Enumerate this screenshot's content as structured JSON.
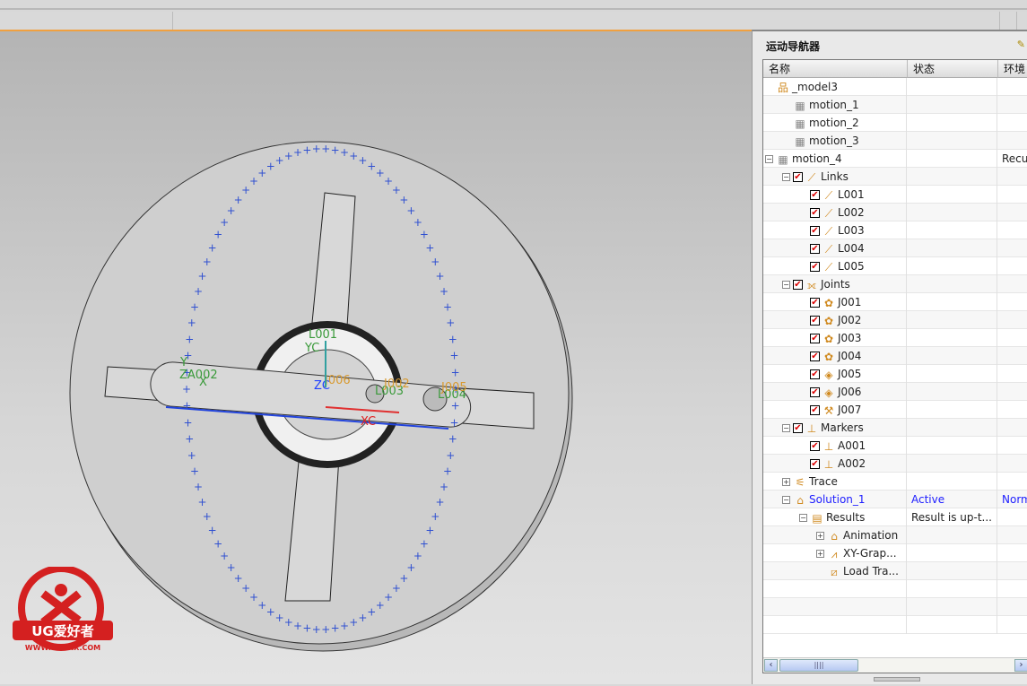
{
  "panel": {
    "title": "运动导航器",
    "columns": [
      "名称",
      "状态",
      "环境"
    ]
  },
  "tree": [
    {
      "indent": 0,
      "exp": "",
      "cb": false,
      "icon": "assembly-tree-icon",
      "glyph": "品",
      "label": "_model3",
      "status": "",
      "env": ""
    },
    {
      "indent": 1,
      "exp": "",
      "cb": false,
      "icon": "motion-sim-icon",
      "glyph": "▦",
      "label": "motion_1",
      "status": "",
      "env": ""
    },
    {
      "indent": 1,
      "exp": "",
      "cb": false,
      "icon": "motion-sim-icon",
      "glyph": "▦",
      "label": "motion_2",
      "status": "",
      "env": ""
    },
    {
      "indent": 1,
      "exp": "",
      "cb": false,
      "icon": "motion-sim-icon",
      "glyph": "▦",
      "label": "motion_3",
      "status": "",
      "env": ""
    },
    {
      "indent": 0,
      "exp": "−",
      "cb": false,
      "icon": "motion-sim-active-icon",
      "glyph": "▦",
      "label": "motion_4",
      "status": "",
      "env": "Recurdyn"
    },
    {
      "indent": 1,
      "exp": "−",
      "cb": true,
      "icon": "links-icon",
      "glyph": "⟋",
      "label": "Links",
      "status": "",
      "env": ""
    },
    {
      "indent": 2,
      "exp": "",
      "cb": true,
      "icon": "link-fixed-icon",
      "glyph": "⟋",
      "label": "L001",
      "status": "",
      "env": ""
    },
    {
      "indent": 2,
      "exp": "",
      "cb": true,
      "icon": "link-icon",
      "glyph": "⟋",
      "label": "L002",
      "status": "",
      "env": ""
    },
    {
      "indent": 2,
      "exp": "",
      "cb": true,
      "icon": "link-icon",
      "glyph": "⟋",
      "label": "L003",
      "status": "",
      "env": ""
    },
    {
      "indent": 2,
      "exp": "",
      "cb": true,
      "icon": "link-icon",
      "glyph": "⟋",
      "label": "L004",
      "status": "",
      "env": ""
    },
    {
      "indent": 2,
      "exp": "",
      "cb": true,
      "icon": "link-icon",
      "glyph": "⟋",
      "label": "L005",
      "status": "",
      "env": ""
    },
    {
      "indent": 1,
      "exp": "−",
      "cb": true,
      "icon": "joints-icon",
      "glyph": "⟗",
      "label": "Joints",
      "status": "",
      "env": ""
    },
    {
      "indent": 2,
      "exp": "",
      "cb": true,
      "icon": "revolute-joint-icon",
      "glyph": "✿",
      "label": "J001",
      "status": "",
      "env": ""
    },
    {
      "indent": 2,
      "exp": "",
      "cb": true,
      "icon": "revolute-joint-icon",
      "glyph": "✿",
      "label": "J002",
      "status": "",
      "env": ""
    },
    {
      "indent": 2,
      "exp": "",
      "cb": true,
      "icon": "revolute-joint-icon",
      "glyph": "✿",
      "label": "J003",
      "status": "",
      "env": ""
    },
    {
      "indent": 2,
      "exp": "",
      "cb": true,
      "icon": "revolute-joint-icon",
      "glyph": "✿",
      "label": "J004",
      "status": "",
      "env": ""
    },
    {
      "indent": 2,
      "exp": "",
      "cb": true,
      "icon": "slider-joint-icon",
      "glyph": "◈",
      "label": "J005",
      "status": "",
      "env": ""
    },
    {
      "indent": 2,
      "exp": "",
      "cb": true,
      "icon": "slider-joint-icon",
      "glyph": "◈",
      "label": "J006",
      "status": "",
      "env": ""
    },
    {
      "indent": 2,
      "exp": "",
      "cb": true,
      "icon": "fixed-joint-icon",
      "glyph": "⚒",
      "label": "J007",
      "status": "",
      "env": ""
    },
    {
      "indent": 1,
      "exp": "−",
      "cb": true,
      "icon": "markers-icon",
      "glyph": "⊥",
      "label": "Markers",
      "status": "",
      "env": ""
    },
    {
      "indent": 2,
      "exp": "",
      "cb": true,
      "icon": "marker-icon",
      "glyph": "⊥",
      "label": "A001",
      "status": "",
      "env": ""
    },
    {
      "indent": 2,
      "exp": "",
      "cb": true,
      "icon": "marker-icon",
      "glyph": "⊥",
      "label": "A002",
      "status": "",
      "env": ""
    },
    {
      "indent": 1,
      "exp": "+",
      "cb": false,
      "icon": "trace-icon",
      "glyph": "⚟",
      "label": "Trace",
      "status": "",
      "env": ""
    },
    {
      "indent": 1,
      "exp": "−",
      "cb": false,
      "icon": "solution-icon",
      "glyph": "⌂",
      "label": "Solution_1",
      "status": "Active",
      "env": "Normal",
      "blue": true
    },
    {
      "indent": 2,
      "exp": "−",
      "cb": false,
      "icon": "results-icon",
      "glyph": "▤",
      "label": "Results",
      "status": "Result is up-t...",
      "env": ""
    },
    {
      "indent": 3,
      "exp": "+",
      "cb": false,
      "icon": "animation-icon",
      "glyph": "⌂",
      "label": "Animation",
      "status": "",
      "env": ""
    },
    {
      "indent": 3,
      "exp": "+",
      "cb": false,
      "icon": "xy-graph-icon",
      "glyph": "⩘",
      "label": "XY-Grap...",
      "status": "",
      "env": ""
    },
    {
      "indent": 3,
      "exp": "",
      "cb": false,
      "icon": "load-transfer-icon",
      "glyph": "⧄",
      "label": "Load Tra...",
      "status": "",
      "env": ""
    }
  ],
  "viewport_labels": {
    "l001": "L001",
    "yc": "YC",
    "za002": "ZA002",
    "y": "Y",
    "x": "X",
    "l003": "L003",
    "j002": "J002",
    "l004": "L004",
    "j005": "J005",
    "j006": "J006",
    "xc": "XC",
    "zc": "ZC"
  },
  "logo": {
    "text": "UG爱好者",
    "url": "WWW.UGSNX.COM"
  },
  "colors": {
    "accent": "#f0a040",
    "link_green": "#3a9a3a",
    "joint_orange": "#d89a30",
    "active_blue": "#2020ff",
    "marker_blue": "#3050d0"
  }
}
